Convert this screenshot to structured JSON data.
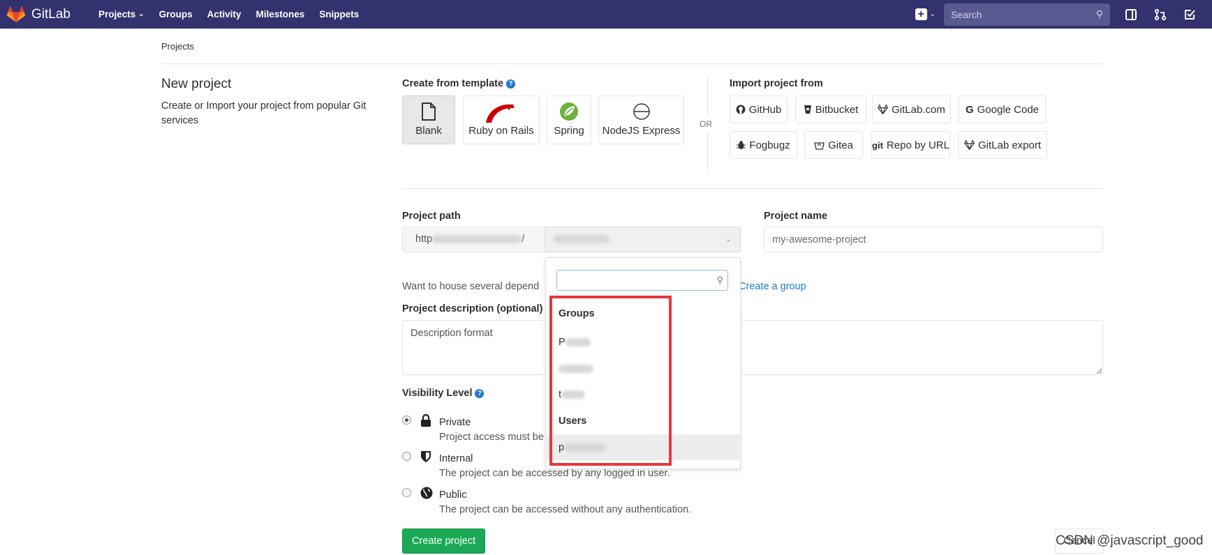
{
  "topbar": {
    "brand": "GitLab",
    "nav": [
      "Projects",
      "Groups",
      "Activity",
      "Milestones",
      "Snippets"
    ],
    "search_placeholder": "Search"
  },
  "breadcrumb": "Projects",
  "page": {
    "title": "New project",
    "subtitle": "Create or Import your project from popular Git services"
  },
  "templates": {
    "label": "Create from template",
    "items": [
      "Blank",
      "Ruby on Rails",
      "Spring",
      "NodeJS Express"
    ]
  },
  "or_text": "OR",
  "import": {
    "label": "Import project from",
    "items": [
      "GitHub",
      "Bitbucket",
      "GitLab.com",
      "Google Code",
      "Fogbugz",
      "Gitea",
      "Repo by URL",
      "GitLab export"
    ],
    "git_badge": "git"
  },
  "form": {
    "path_label": "Project path",
    "path_prefix_visible": "http",
    "path_prefix_tail": "/",
    "name_label": "Project name",
    "name_placeholder": "my-awesome-project",
    "house_text": "Want to house several depend",
    "create_group": "Create a group",
    "desc_label": "Project description (optional)",
    "desc_placeholder": "Description format",
    "visibility_label": "Visibility Level",
    "visibility": [
      {
        "name": "Private",
        "desc": "Project access must be",
        "checked": true
      },
      {
        "name": "Internal",
        "desc": "The project can be accessed by any logged in user.",
        "checked": false
      },
      {
        "name": "Public",
        "desc": "The project can be accessed without any authentication.",
        "checked": false
      }
    ],
    "create_button": "Create project",
    "cancel_button": "Cancel"
  },
  "dropdown": {
    "groups_header": "Groups",
    "users_header": "Users",
    "group_item_fragments": [
      "P",
      "...",
      "t"
    ],
    "user_item_fragment": "p"
  },
  "watermark": "CSDN @javascript_good",
  "colors": {
    "topbar": "#33316e",
    "primary_green": "#1aaa55",
    "link_blue": "#1f78d1",
    "highlight_red": "#e8373d"
  }
}
